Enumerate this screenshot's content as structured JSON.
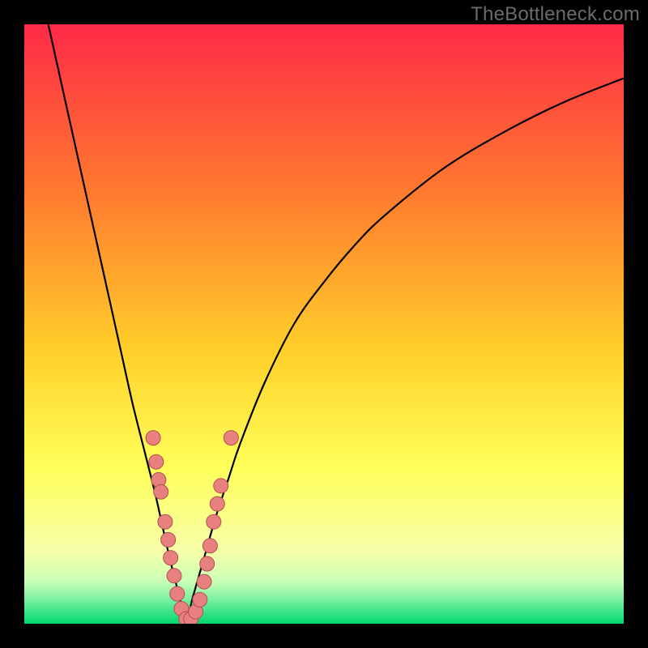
{
  "watermark": "TheBottleneck.com",
  "colors": {
    "frame": "#000000",
    "grad_top": "#ff2a47",
    "grad_mid1": "#ff8a2a",
    "grad_mid2": "#ffd82a",
    "grad_mid3": "#ffff70",
    "grad_low": "#f4ffb0",
    "grad_green1": "#8ef2a8",
    "grad_green2": "#00d870",
    "curve": "#000000",
    "marker_fill": "#e98080",
    "marker_stroke": "#b05050"
  },
  "chart_data": {
    "type": "line",
    "title": "",
    "xlabel": "",
    "ylabel": "",
    "xlim": [
      0,
      100
    ],
    "ylim": [
      0,
      100
    ],
    "note": "V-shaped bottleneck curve; y rises from 0 toward ~100 as x moves away from the minimum at x≈27. Values estimated from pixel positions; no axis ticks are shown.",
    "x_min_at": 27,
    "series": [
      {
        "name": "bottleneck-curve",
        "x": [
          4,
          8,
          12,
          16,
          18,
          20,
          22,
          24,
          26,
          27,
          28,
          30,
          32,
          34,
          36,
          40,
          45,
          50,
          55,
          60,
          70,
          80,
          90,
          100
        ],
        "y": [
          100,
          82,
          64,
          46,
          37,
          29,
          21,
          12,
          4,
          0,
          4,
          11,
          18,
          24,
          30,
          40,
          50,
          57,
          63,
          68,
          76,
          82,
          87,
          91
        ]
      }
    ],
    "markers": {
      "name": "highlighted-points",
      "note": "Pink bead markers clustered near the curve minimum on both branches",
      "points": [
        {
          "x": 21.5,
          "y": 31
        },
        {
          "x": 22.0,
          "y": 27
        },
        {
          "x": 22.4,
          "y": 24
        },
        {
          "x": 22.8,
          "y": 22
        },
        {
          "x": 23.5,
          "y": 17
        },
        {
          "x": 24.0,
          "y": 14
        },
        {
          "x": 24.4,
          "y": 11
        },
        {
          "x": 25.0,
          "y": 8
        },
        {
          "x": 25.5,
          "y": 5
        },
        {
          "x": 26.2,
          "y": 2.5
        },
        {
          "x": 27.0,
          "y": 0.8
        },
        {
          "x": 27.8,
          "y": 0.8
        },
        {
          "x": 28.6,
          "y": 2.0
        },
        {
          "x": 29.3,
          "y": 4.0
        },
        {
          "x": 30.0,
          "y": 7.0
        },
        {
          "x": 30.5,
          "y": 10.0
        },
        {
          "x": 31.0,
          "y": 13.0
        },
        {
          "x": 31.6,
          "y": 17.0
        },
        {
          "x": 32.2,
          "y": 20.0
        },
        {
          "x": 32.8,
          "y": 23.0
        },
        {
          "x": 34.5,
          "y": 31.0
        }
      ]
    }
  }
}
